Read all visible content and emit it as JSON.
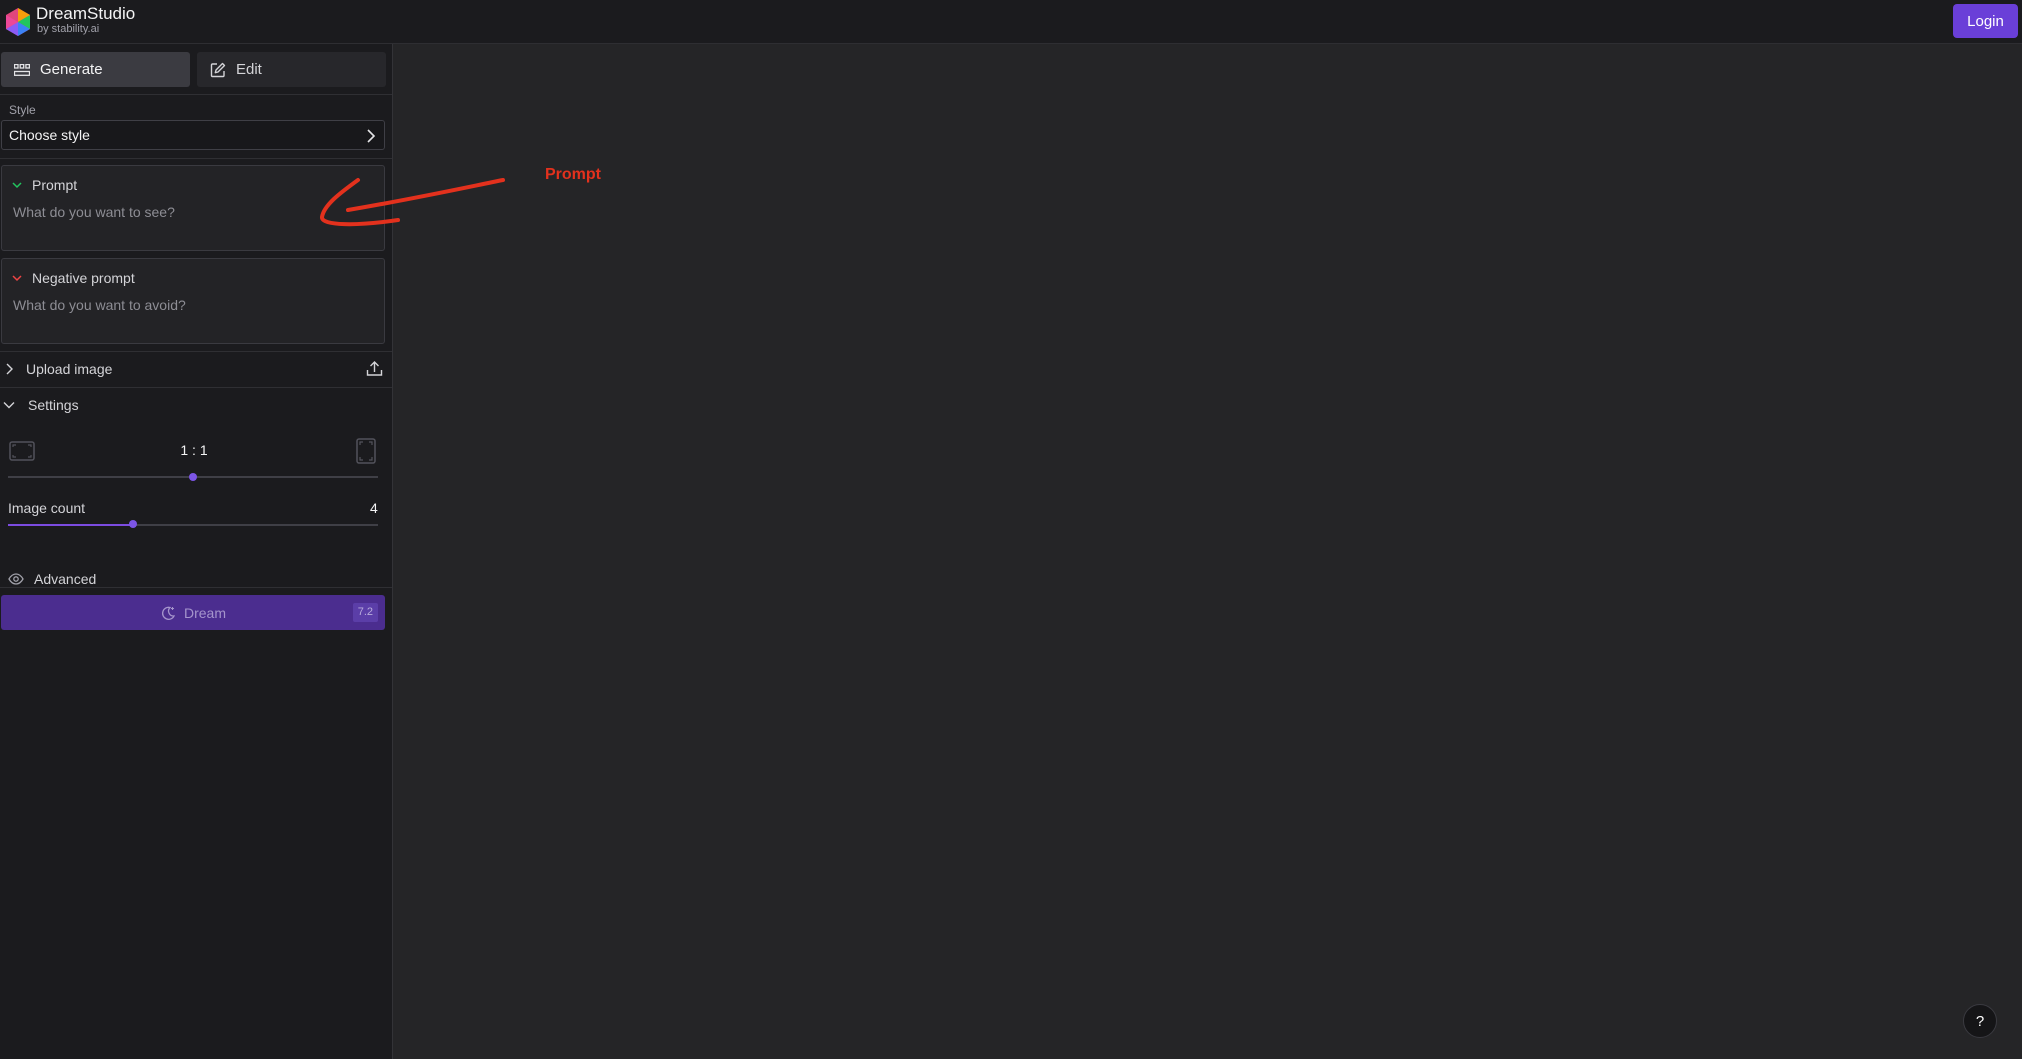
{
  "header": {
    "app_title": "DreamStudio",
    "app_subtitle": "by stability.ai",
    "login_label": "Login",
    "accent_color": "#6a3fd8"
  },
  "tabs": [
    {
      "label": "Generate",
      "icon": "grid-icon",
      "active": true
    },
    {
      "label": "Edit",
      "icon": "edit-icon",
      "active": false
    }
  ],
  "style": {
    "label": "Style",
    "value": "Choose style"
  },
  "prompt": {
    "label": "Prompt",
    "placeholder": "What do you want to see?",
    "icon_color": "#22c55e"
  },
  "negative_prompt": {
    "label": "Negative prompt",
    "placeholder": "What do you want to avoid?",
    "icon_color": "#ef4444"
  },
  "upload": {
    "label": "Upload image"
  },
  "settings": {
    "label": "Settings",
    "aspect_ratio": "1 : 1",
    "image_count_label": "Image count",
    "image_count_value": "4",
    "advanced_label": "Advanced"
  },
  "dream": {
    "label": "Dream",
    "cost": "7.2"
  },
  "annotation": {
    "label": "Prompt",
    "color": "#e3311d"
  },
  "help": {
    "label": "?"
  }
}
